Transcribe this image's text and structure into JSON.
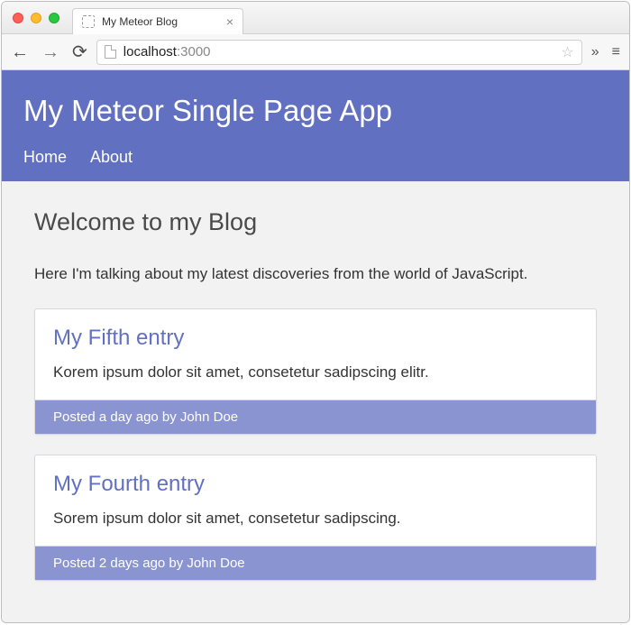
{
  "browser": {
    "tab_title": "My Meteor Blog",
    "address_host": "localhost",
    "address_port": ":3000"
  },
  "header": {
    "title": "My Meteor Single Page App",
    "nav": [
      "Home",
      "About"
    ]
  },
  "page": {
    "title": "Welcome to my Blog",
    "intro": "Here I'm talking about my latest discoveries from the world of JavaScript."
  },
  "posts": [
    {
      "title": "My Fifth entry",
      "excerpt": "Korem ipsum dolor sit amet, consetetur sadipscing elitr.",
      "meta": "Posted a day ago by John Doe"
    },
    {
      "title": "My Fourth entry",
      "excerpt": "Sorem ipsum dolor sit amet, consetetur sadipscing.",
      "meta": "Posted 2 days ago by John Doe"
    }
  ]
}
